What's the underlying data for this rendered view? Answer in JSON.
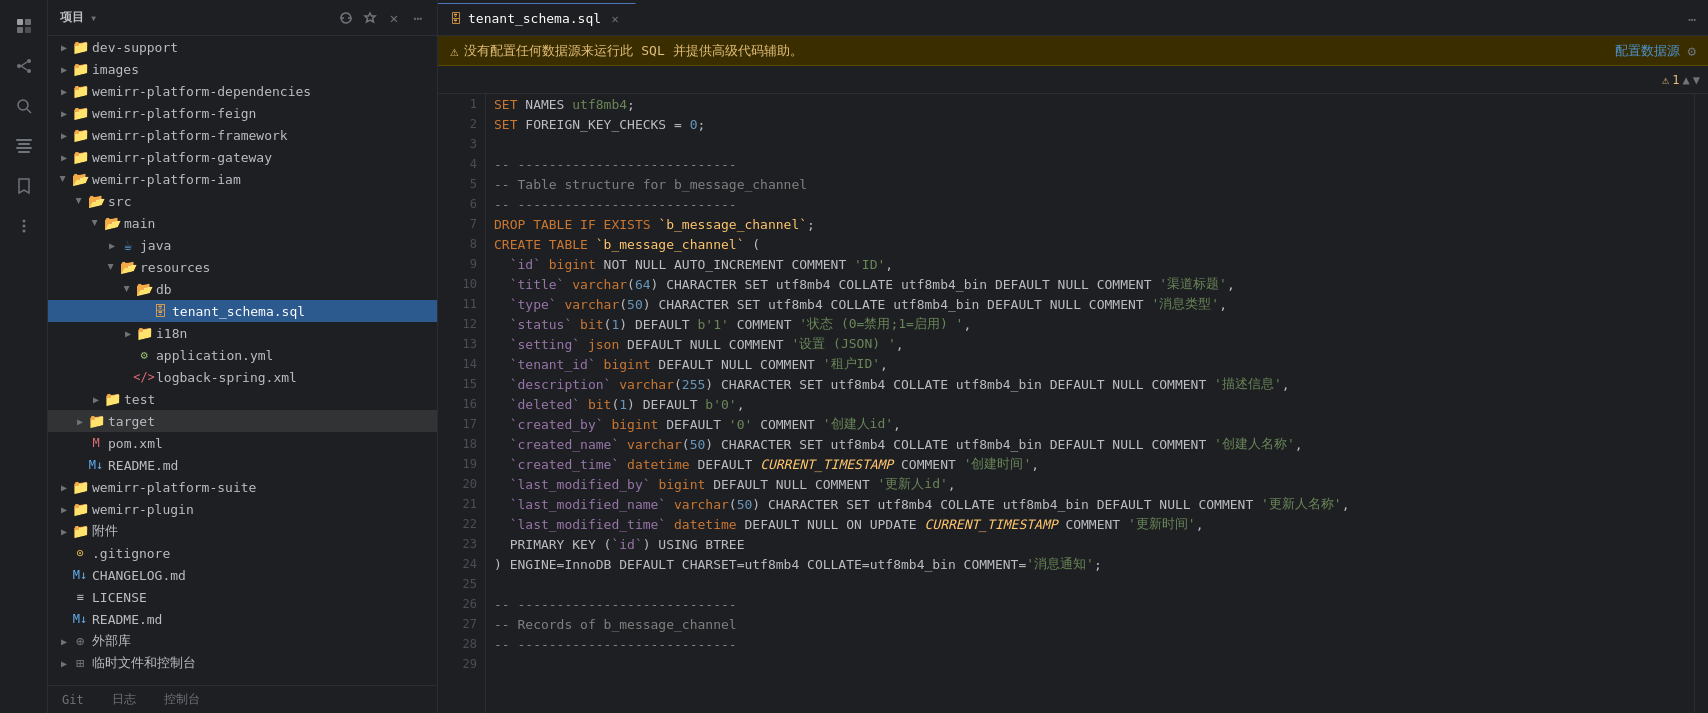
{
  "app": {
    "title": "项目",
    "tab_label": "tenant_schema.sql"
  },
  "activity_bar": {
    "icons": [
      "project",
      "git",
      "search",
      "structure",
      "bookmark",
      "more"
    ]
  },
  "sidebar": {
    "title": "项目",
    "items": [
      {
        "id": "dev-support",
        "label": "dev-support",
        "type": "folder",
        "depth": 1,
        "open": false
      },
      {
        "id": "images",
        "label": "images",
        "type": "folder",
        "depth": 1,
        "open": false
      },
      {
        "id": "wemirr-platform-dependencies",
        "label": "wemirr-platform-dependencies",
        "type": "folder",
        "depth": 1,
        "open": false
      },
      {
        "id": "wemirr-platform-feign",
        "label": "wemirr-platform-feign",
        "type": "folder",
        "depth": 1,
        "open": false
      },
      {
        "id": "wemirr-platform-framework",
        "label": "wemirr-platform-framework",
        "type": "folder",
        "depth": 1,
        "open": false
      },
      {
        "id": "wemirr-platform-gateway",
        "label": "wemirr-platform-gateway",
        "type": "folder",
        "depth": 1,
        "open": false
      },
      {
        "id": "wemirr-platform-iam",
        "label": "wemirr-platform-iam",
        "type": "folder",
        "depth": 1,
        "open": true
      },
      {
        "id": "src",
        "label": "src",
        "type": "folder",
        "depth": 2,
        "open": true
      },
      {
        "id": "main",
        "label": "main",
        "type": "folder",
        "depth": 3,
        "open": true
      },
      {
        "id": "java",
        "label": "java",
        "type": "folder",
        "depth": 4,
        "open": false
      },
      {
        "id": "resources",
        "label": "resources",
        "type": "folder",
        "depth": 4,
        "open": true
      },
      {
        "id": "db",
        "label": "db",
        "type": "folder",
        "depth": 5,
        "open": true
      },
      {
        "id": "tenant_schema.sql",
        "label": "tenant_schema.sql",
        "type": "file-sql",
        "depth": 6,
        "open": false,
        "selected": true
      },
      {
        "id": "i18n",
        "label": "i18n",
        "type": "folder",
        "depth": 5,
        "open": false
      },
      {
        "id": "application.yml",
        "label": "application.yml",
        "type": "file-yml",
        "depth": 5,
        "open": false
      },
      {
        "id": "logback-spring.xml",
        "label": "logback-spring.xml",
        "type": "file-xml",
        "depth": 5,
        "open": false
      },
      {
        "id": "test",
        "label": "test",
        "type": "folder",
        "depth": 3,
        "open": false
      },
      {
        "id": "target",
        "label": "target",
        "type": "folder",
        "depth": 2,
        "open": false,
        "highlighted": true
      },
      {
        "id": "pom.xml",
        "label": "pom.xml",
        "type": "file-pom",
        "depth": 2,
        "open": false
      },
      {
        "id": "README.md",
        "label": "README.md",
        "type": "file-md",
        "depth": 2,
        "open": false
      },
      {
        "id": "wemirr-platform-suite",
        "label": "wemirr-platform-suite",
        "type": "folder",
        "depth": 1,
        "open": false
      },
      {
        "id": "wemirr-plugin",
        "label": "wemirr-plugin",
        "type": "folder",
        "depth": 1,
        "open": false
      },
      {
        "id": "附件",
        "label": "附件",
        "type": "folder",
        "depth": 1,
        "open": false
      },
      {
        "id": ".gitignore",
        "label": ".gitignore",
        "type": "file-git",
        "depth": 1,
        "open": false
      },
      {
        "id": "CHANGELOG.md",
        "label": "CHANGELOG.md",
        "type": "file-md",
        "depth": 1,
        "open": false
      },
      {
        "id": "LICENSE",
        "label": "LICENSE",
        "type": "file-txt",
        "depth": 1,
        "open": false
      },
      {
        "id": "README2.md",
        "label": "README.md",
        "type": "file-md",
        "depth": 1,
        "open": false
      }
    ],
    "bottom_items": [
      {
        "id": "external",
        "label": "外部库",
        "type": "folder",
        "depth": 0,
        "open": false
      },
      {
        "id": "scratch",
        "label": "临时文件和控制台",
        "type": "folder",
        "depth": 0,
        "open": false
      }
    ]
  },
  "editor": {
    "warning_text": "没有配置任何数据源来运行此 SQL 并提供高级代码辅助。",
    "config_btn_label": "配置数据源",
    "lines": [
      {
        "num": 1,
        "text": "SET NAMES utf8mb4;"
      },
      {
        "num": 2,
        "text": "SET FOREIGN_KEY_CHECKS = 0;"
      },
      {
        "num": 3,
        "text": ""
      },
      {
        "num": 4,
        "text": "-- ----------------------------"
      },
      {
        "num": 5,
        "text": "-- Table structure for b_message_channel"
      },
      {
        "num": 6,
        "text": "-- ----------------------------"
      },
      {
        "num": 7,
        "text": "DROP TABLE IF EXISTS `b_message_channel`;"
      },
      {
        "num": 8,
        "text": "CREATE TABLE `b_message_channel` ("
      },
      {
        "num": 9,
        "text": "  `id` bigint NOT NULL AUTO_INCREMENT COMMENT 'ID',"
      },
      {
        "num": 10,
        "text": "  `title` varchar(64) CHARACTER SET utf8mb4 COLLATE utf8mb4_bin DEFAULT NULL COMMENT '渠道标题',"
      },
      {
        "num": 11,
        "text": "  `type` varchar(50) CHARACTER SET utf8mb4 COLLATE utf8mb4_bin DEFAULT NULL COMMENT '消息类型',"
      },
      {
        "num": 12,
        "text": "  `status` bit(1) DEFAULT b'1' COMMENT '状态 (0=禁用;1=启用) ',"
      },
      {
        "num": 13,
        "text": "  `setting` json DEFAULT NULL COMMENT '设置 (JSON) ',"
      },
      {
        "num": 14,
        "text": "  `tenant_id` bigint DEFAULT NULL COMMENT '租户ID',"
      },
      {
        "num": 15,
        "text": "  `description` varchar(255) CHARACTER SET utf8mb4 COLLATE utf8mb4_bin DEFAULT NULL COMMENT '描述信息',"
      },
      {
        "num": 16,
        "text": "  `deleted` bit(1) DEFAULT b'0',"
      },
      {
        "num": 17,
        "text": "  `created_by` bigint DEFAULT '0' COMMENT '创建人id',"
      },
      {
        "num": 18,
        "text": "  `created_name` varchar(50) CHARACTER SET utf8mb4 COLLATE utf8mb4_bin DEFAULT NULL COMMENT '创建人名称',"
      },
      {
        "num": 19,
        "text": "  `created_time` datetime DEFAULT CURRENT_TIMESTAMP COMMENT '创建时间',"
      },
      {
        "num": 20,
        "text": "  `last_modified_by` bigint DEFAULT NULL COMMENT '更新人id',"
      },
      {
        "num": 21,
        "text": "  `last_modified_name` varchar(50) CHARACTER SET utf8mb4 COLLATE utf8mb4_bin DEFAULT NULL COMMENT '更新人名称',"
      },
      {
        "num": 22,
        "text": "  `last_modified_time` datetime DEFAULT NULL ON UPDATE CURRENT_TIMESTAMP COMMENT '更新时间',"
      },
      {
        "num": 23,
        "text": "  PRIMARY KEY (`id`) USING BTREE"
      },
      {
        "num": 24,
        "text": ") ENGINE=InnoDB DEFAULT CHARSET=utf8mb4 COLLATE=utf8mb4_bin COMMENT='消息通知';"
      },
      {
        "num": 25,
        "text": ""
      },
      {
        "num": 26,
        "text": "-- ----------------------------"
      },
      {
        "num": 27,
        "text": "-- Records of b_message_channel"
      },
      {
        "num": 28,
        "text": "-- ----------------------------"
      },
      {
        "num": 29,
        "text": ""
      }
    ]
  },
  "bottom_tabs": {
    "items": [
      "Git",
      "日志",
      "控制台"
    ]
  }
}
